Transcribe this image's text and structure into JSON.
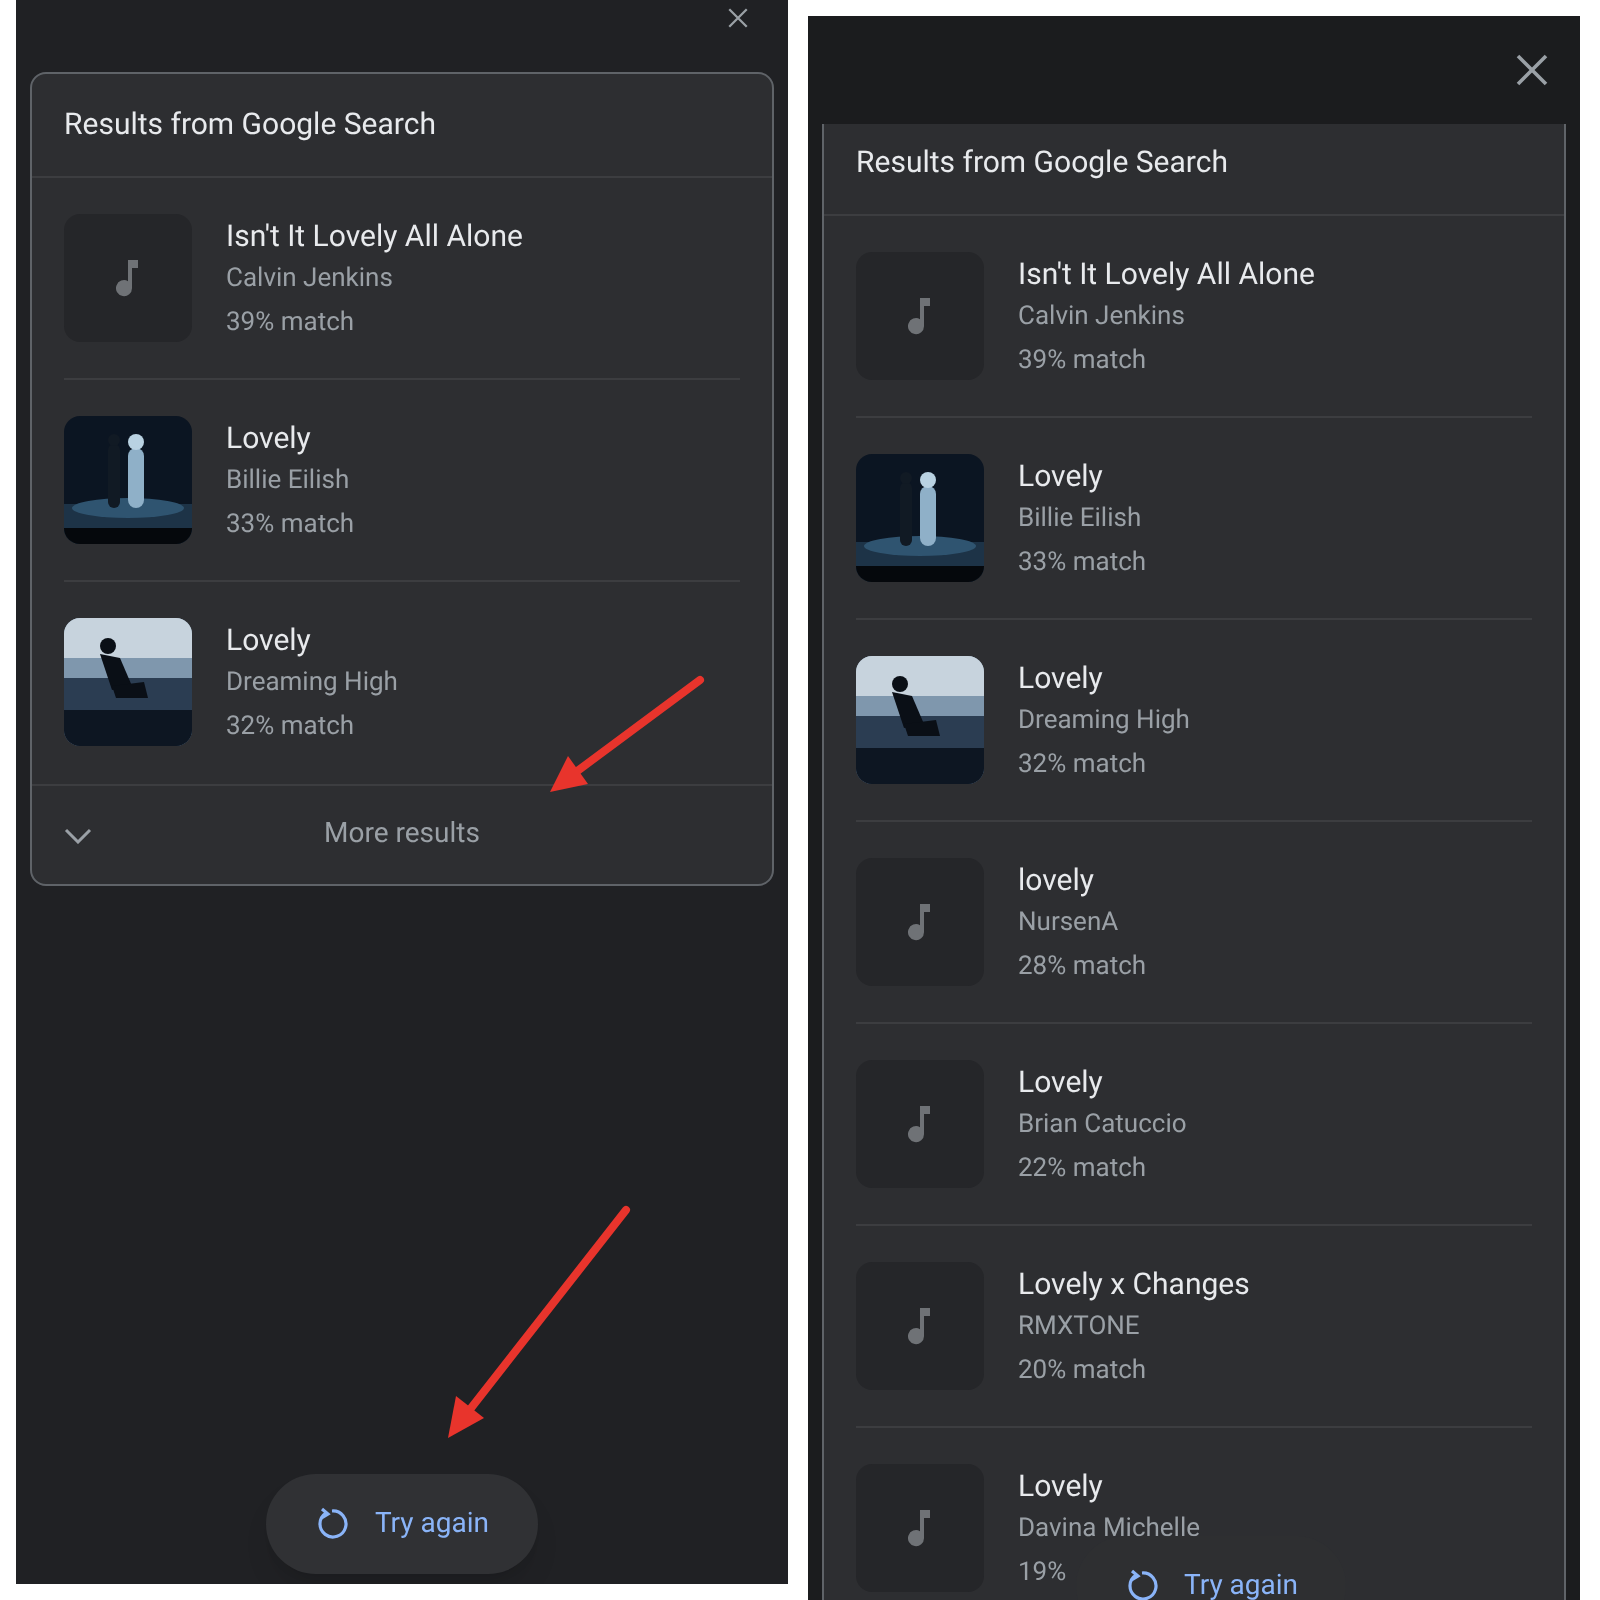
{
  "panels": [
    {
      "header": "Results from Google Search",
      "results": [
        {
          "kind": "note",
          "title": "Isn't It Lovely All Alone",
          "artist": "Calvin Jenkins",
          "match": "39% match"
        },
        {
          "kind": "picture",
          "title": "Lovely",
          "artist": "Billie Eilish",
          "match": "33% match"
        },
        {
          "kind": "picture",
          "title": "Lovely",
          "artist": "Dreaming High",
          "match": "32% match"
        }
      ],
      "more_results": "More results",
      "try_again": "Try again"
    },
    {
      "header": "Results from Google Search",
      "results": [
        {
          "kind": "note",
          "title": "Isn't It Lovely All Alone",
          "artist": "Calvin Jenkins",
          "match": "39% match"
        },
        {
          "kind": "picture",
          "title": "Lovely",
          "artist": "Billie Eilish",
          "match": "33% match"
        },
        {
          "kind": "picture",
          "title": "Lovely",
          "artist": "Dreaming High",
          "match": "32% match"
        },
        {
          "kind": "note",
          "title": "lovely",
          "artist": "NursenA",
          "match": "28% match"
        },
        {
          "kind": "note",
          "title": "Lovely",
          "artist": "Brian Catuccio",
          "match": "22% match"
        },
        {
          "kind": "note",
          "title": "Lovely x Changes",
          "artist": "RMXTONE",
          "match": "20% match"
        },
        {
          "kind": "note",
          "title": "Lovely",
          "artist": "Davina Michelle",
          "match": "19%"
        }
      ],
      "try_again": "Try again"
    }
  ]
}
